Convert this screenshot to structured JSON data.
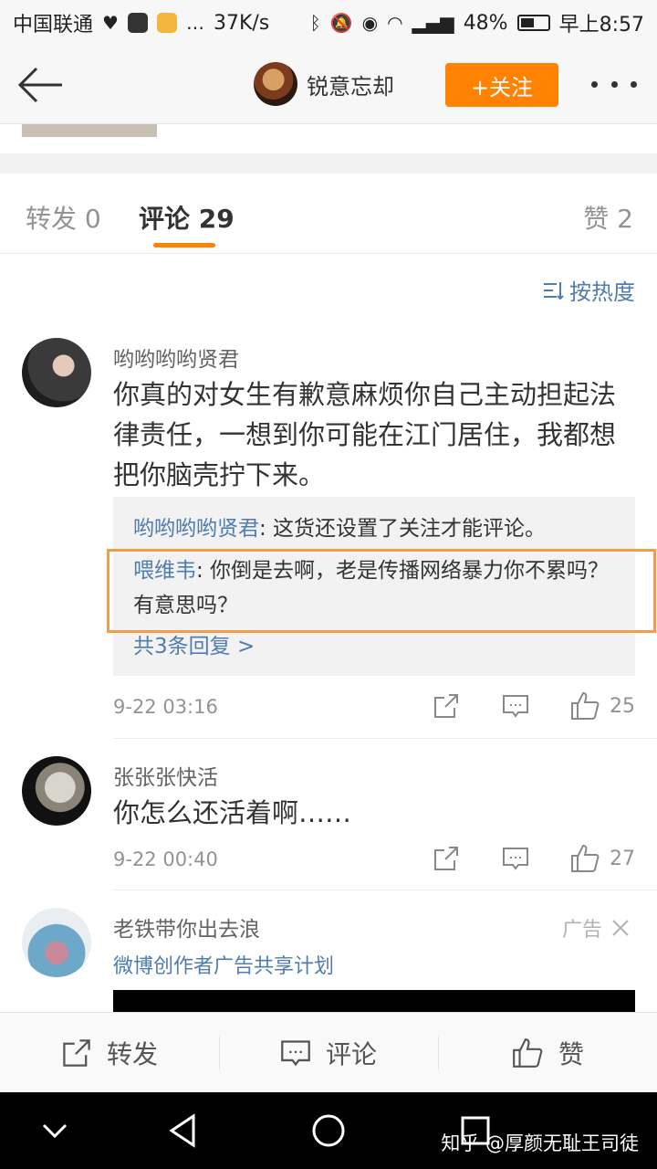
{
  "status_bar": {
    "carrier": "中国联通",
    "speed": "37K/s",
    "battery": "48%",
    "time": "早上8:57"
  },
  "nav": {
    "username": "锐意忘却",
    "follow_label": "+关注"
  },
  "tabs": [
    {
      "label": "转发 0"
    },
    {
      "label": "评论 29"
    },
    {
      "label": "赞 2"
    }
  ],
  "sort_label": "按热度",
  "comments": [
    {
      "name": "哟哟哟哟贤君",
      "text": "你真的对女生有歉意麻烦你自己主动担起法律责任，一想到你可能在江门居住，我都想把你脑壳拧下来。",
      "replies": [
        {
          "name": "哟哟哟哟贤君",
          "text": ": 这货还设置了关注才能评论。"
        },
        {
          "name": "喂维韦",
          "text": ": 你倒是去啊，老是传播网络暴力你不累吗？有意思吗？"
        }
      ],
      "more_replies": "共3条回复 >",
      "time": "9-22 03:16",
      "likes": "25"
    },
    {
      "name": "张张张快活",
      "text": "你怎么还活着啊……",
      "time": "9-22 00:40",
      "likes": "27"
    }
  ],
  "ad": {
    "name": "老铁带你出去浪",
    "subtitle": "微博创作者广告共享计划",
    "tag": "广告"
  },
  "toolbar": {
    "repost": "转发",
    "comment": "评论",
    "like": "赞"
  },
  "watermark": "知乎 @厚颜无耻王司徒",
  "colors": {
    "accent": "#ff8200",
    "link": "#507daf",
    "highlight_box": "#f29d4b"
  }
}
